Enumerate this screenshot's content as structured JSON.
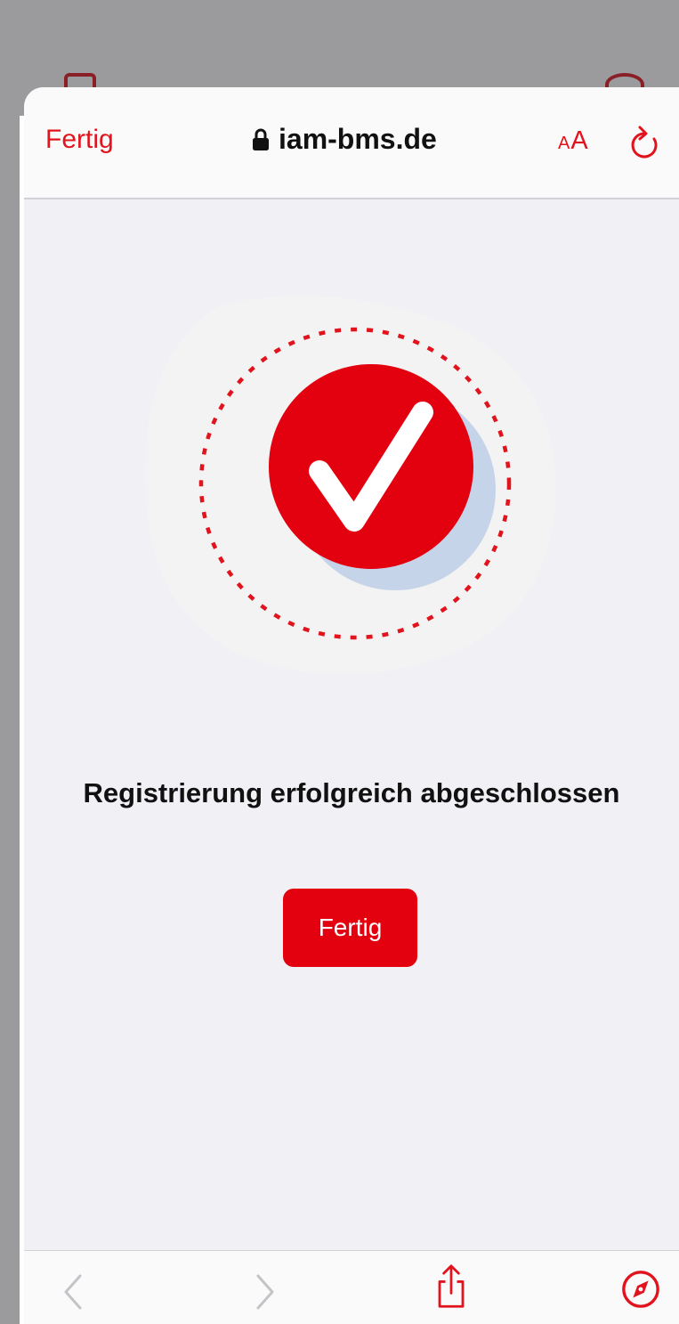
{
  "browser": {
    "done_label": "Fertig",
    "url": "iam-bms.de",
    "text_size_small": "A",
    "text_size_large": "A"
  },
  "page": {
    "headline": "Registrierung erfolgreich abgeschlossen",
    "done_button_label": "Fertig"
  },
  "colors": {
    "accent": "#e3000f",
    "sheet_background": "#f1f0f5",
    "shadow_blob": "#c6d4ea"
  },
  "icons": {
    "lock": "lock-icon",
    "reload": "reload-icon",
    "back": "chevron-left-icon",
    "forward": "chevron-right-icon",
    "share": "share-icon",
    "compass": "compass-icon",
    "success": "checkmark-icon"
  }
}
